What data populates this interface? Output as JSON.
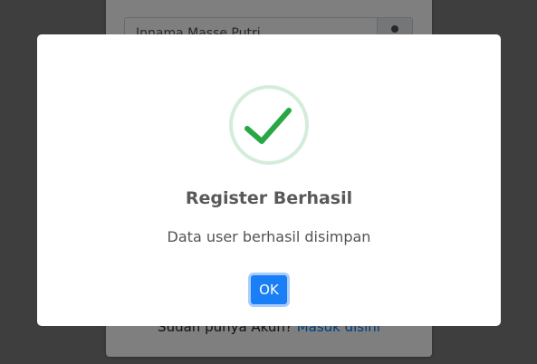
{
  "background_form": {
    "name_value": "Innama Masse Putri",
    "icon": "user-icon",
    "footer_prefix": "Sudah punya Akun?",
    "footer_link": "Masuk disini"
  },
  "dialog": {
    "icon": "success-check-icon",
    "title": "Register Berhasil",
    "message": "Data user berhasil disimpan",
    "ok_label": "OK"
  },
  "colors": {
    "success": "#28a745",
    "button": "#1a7ff6",
    "link": "#007bff"
  }
}
